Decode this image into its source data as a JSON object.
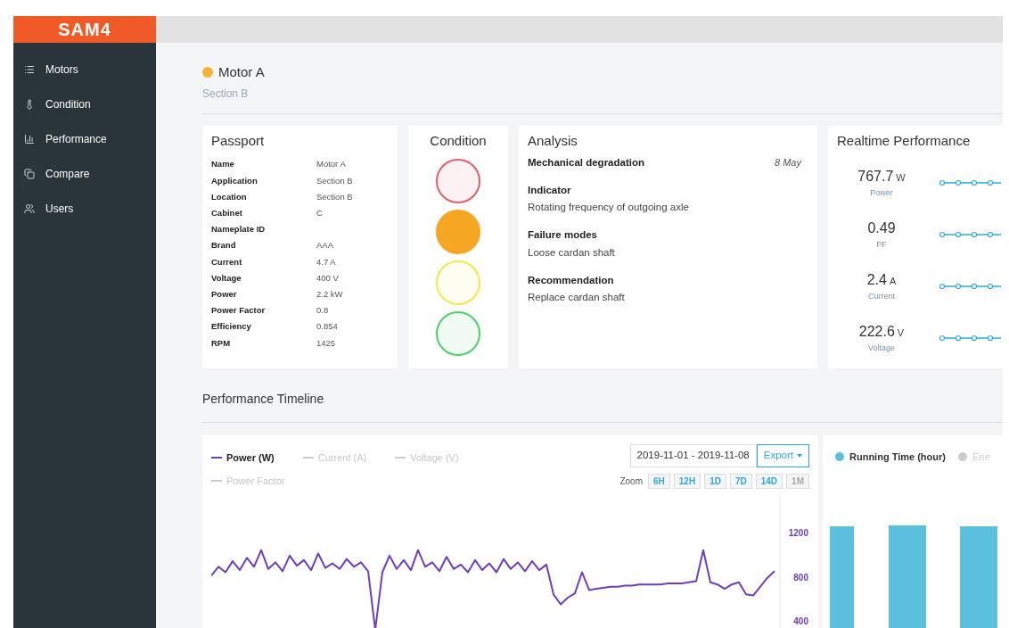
{
  "logo": "SAM4",
  "sidebar": {
    "items": [
      {
        "label": "Motors"
      },
      {
        "label": "Condition"
      },
      {
        "label": "Performance"
      },
      {
        "label": "Compare"
      },
      {
        "label": "Users"
      }
    ]
  },
  "motor": {
    "name": "Motor A",
    "color": "#f5b335",
    "section": "Section B"
  },
  "passport": {
    "title": "Passport",
    "rows": [
      {
        "label": "Name",
        "value": "Motor A"
      },
      {
        "label": "Application",
        "value": "Section B"
      },
      {
        "label": "Location",
        "value": "Section B"
      },
      {
        "label": "Cabinet",
        "value": "C"
      },
      {
        "label": "Nameplate ID"
      },
      {
        "label": "Brand",
        "value": "AAA"
      },
      {
        "label": "Current",
        "value": "4.7 A"
      },
      {
        "label": "Voltage",
        "value": "400 V"
      },
      {
        "label": "Power",
        "value": "2.2 kW"
      },
      {
        "label": "Power Factor",
        "value": "0.8"
      },
      {
        "label": "Efficiency",
        "value": "0.854"
      },
      {
        "label": "RPM",
        "value": "1425"
      }
    ]
  },
  "condition": {
    "title": "Condition",
    "lights": [
      {
        "color": "#e35d6a",
        "on": false
      },
      {
        "color": "#f5a623",
        "on": true
      },
      {
        "color": "#eeea48",
        "on": false
      },
      {
        "color": "#4cd068",
        "on": false
      }
    ]
  },
  "analysis": {
    "title": "Analysis",
    "heading": "Mechanical degradation",
    "date": "8 May",
    "sections": [
      {
        "label": "Indicator",
        "text": "Rotating frequency of outgoing axle"
      },
      {
        "label": "Failure modes",
        "text": "Loose cardan shaft"
      },
      {
        "label": "Recommendation",
        "text": "Replace cardan shaft"
      }
    ]
  },
  "realtime": {
    "title": "Realtime Performance",
    "metrics": [
      {
        "value": "767.7",
        "unit": "W",
        "label": "Power"
      },
      {
        "value": "0.49",
        "label": "PF"
      },
      {
        "value": "2.4",
        "unit": "A",
        "label": "Current"
      },
      {
        "value": "222.6",
        "unit": "V",
        "label": "Voltage"
      }
    ]
  },
  "timeline": {
    "title": "Performance Timeline",
    "legend": [
      {
        "label": "Current (A)",
        "selected": false
      },
      {
        "label": "Voltage (V)",
        "selected": false
      },
      {
        "label": "Power Factor",
        "selected": false
      }
    ],
    "date_range": "2019-11-01 - 2019-11-08",
    "export": "Export",
    "zoom_label": "Zoom",
    "zoom": [
      {
        "label": "6H",
        "disabled": false
      },
      {
        "label": "12H",
        "disabled": false
      },
      {
        "label": "1D",
        "disabled": false
      },
      {
        "label": "7D",
        "disabled": false
      },
      {
        "label": "14D",
        "disabled": false
      },
      {
        "label": "1M",
        "disabled": true
      }
    ],
    "chart_data": {
      "type": "line",
      "ylim": [
        330,
        1540
      ],
      "yticks": [
        400,
        800,
        1200
      ],
      "series": [
        {
          "name": "Power (W)",
          "color": "#6a3fc0",
          "values": [
            820,
            900,
            850,
            950,
            870,
            980,
            900,
            1050,
            880,
            940,
            860,
            1000,
            910,
            960,
            870,
            1020,
            890,
            930,
            880,
            970,
            900,
            940,
            860,
            330,
            850,
            1000,
            880,
            960,
            870,
            1050,
            900,
            940,
            860,
            990,
            880,
            920,
            850,
            960,
            870,
            930,
            850,
            970,
            880,
            940,
            860,
            950,
            870,
            920,
            650,
            560,
            620,
            660,
            850,
            690,
            700,
            710,
            720,
            720,
            730,
            730,
            740,
            740,
            740,
            740,
            750,
            750,
            750,
            760,
            770,
            1050,
            760,
            740,
            700,
            740,
            760,
            650,
            640,
            720,
            800,
            860
          ]
        }
      ]
    }
  },
  "running": {
    "legend": [
      {
        "label": "Running Time (hour)",
        "selected": true
      },
      {
        "label": "Ene",
        "selected": false
      }
    ]
  }
}
